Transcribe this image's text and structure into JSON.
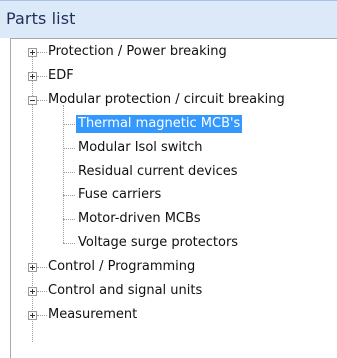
{
  "panel": {
    "title": "Parts list"
  },
  "tree": {
    "selected_color": "#3399ff",
    "nodes": [
      {
        "label": "Protection / Power breaking",
        "state": "collapsed",
        "level": 0
      },
      {
        "label": "EDF",
        "state": "collapsed",
        "level": 0
      },
      {
        "label": "Modular protection / circuit breaking",
        "state": "expanded",
        "level": 0
      },
      {
        "label": "Thermal magnetic MCB's",
        "state": "leaf",
        "level": 1,
        "selected": true
      },
      {
        "label": "Modular Isol switch",
        "state": "leaf",
        "level": 1
      },
      {
        "label": "Residual current devices",
        "state": "leaf",
        "level": 1
      },
      {
        "label": "Fuse carriers",
        "state": "leaf",
        "level": 1
      },
      {
        "label": "Motor-driven MCBs",
        "state": "leaf",
        "level": 1
      },
      {
        "label": "Voltage surge protectors",
        "state": "leaf",
        "level": 1
      },
      {
        "label": "Control / Programming",
        "state": "collapsed",
        "level": 0
      },
      {
        "label": "Control and signal units",
        "state": "collapsed",
        "level": 0
      },
      {
        "label": "Measurement",
        "state": "collapsed",
        "level": 0
      }
    ]
  }
}
